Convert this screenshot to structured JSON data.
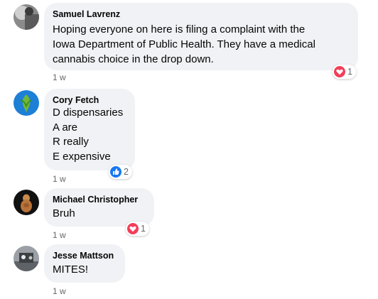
{
  "comments": [
    {
      "author": "Samuel Lavrenz",
      "text": "Hoping everyone on here is filing a complaint with the\nIowa Department of Public Health. They have a medical\ncannabis choice in the drop down.",
      "time": "1 w",
      "reaction": {
        "icon": "love-reaction-icon",
        "count": "1"
      }
    },
    {
      "author": "Cory Fetch",
      "text": "D dispensaries\nA are\nR really\nE expensive",
      "time": "1 w",
      "reaction": {
        "icon": "like-reaction-icon",
        "count": "2"
      }
    },
    {
      "author": "Michael Christopher",
      "text": "Bruh",
      "time": "1 w",
      "reaction": {
        "icon": "love-reaction-icon",
        "count": "1"
      }
    },
    {
      "author": "Jesse Mattson",
      "text": "MITES!",
      "time": "1 w"
    }
  ],
  "colors": {
    "bubble": "#f0f2f5",
    "name": "#050505",
    "meta": "#65676b",
    "love": "#f33e58",
    "like": "#1877f2"
  }
}
